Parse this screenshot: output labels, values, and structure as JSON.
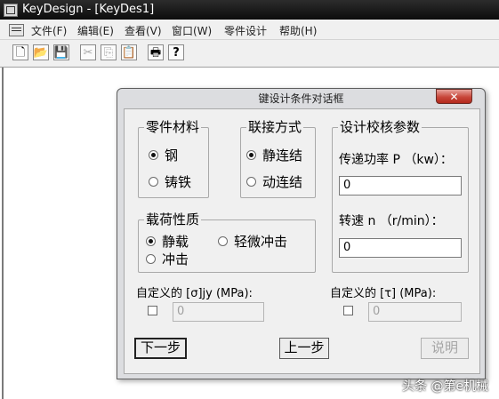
{
  "window": {
    "title": "KeyDesign - [KeyDes1]"
  },
  "menu": [
    "文件(F)",
    "编辑(E)",
    "查看(V)",
    "窗口(W)",
    "零件设计",
    "帮助(H)"
  ],
  "toolbar": {
    "new_icon": "new-file-icon",
    "open_icon": "open-folder-icon",
    "save_icon": "save-disk-icon",
    "cut_icon": "cut-icon",
    "copy_icon": "copy-icon",
    "paste_icon": "paste-icon",
    "print_icon": "print-icon",
    "help_icon": "help-icon",
    "glyphs": {
      "new": "🗋",
      "open": "📂",
      "save": "💾",
      "cut": "✂",
      "copy": "⎘",
      "paste": "📋",
      "print": "🖶",
      "help": "?"
    }
  },
  "dialog": {
    "title": "键设计条件对话框",
    "close_glyph": "✕",
    "material": {
      "legend": "零件材料",
      "options": [
        "钢",
        "铸铁"
      ],
      "selected": "钢"
    },
    "connection": {
      "legend": "联接方式",
      "options": [
        "静连结",
        "动连结"
      ],
      "selected": "静连结"
    },
    "load": {
      "legend": "载荷性质",
      "options": [
        "静载",
        "轻微冲击",
        "冲击"
      ],
      "selected": "静载"
    },
    "params": {
      "legend": "设计校核参数",
      "power_label": "传递功率 P （kw）：",
      "power_value": "0",
      "speed_label": "转速 n （r/min）：",
      "speed_value": "0"
    },
    "custom_sigma": {
      "label": "自定义的 [σ]jy  (MPa):",
      "checked": false,
      "value": "0"
    },
    "custom_tau": {
      "label": "自定义的 [τ]  (MPa):",
      "checked": false,
      "value": "0"
    },
    "buttons": {
      "next": "下一步",
      "prev": "上一步",
      "explain": "说明"
    }
  },
  "watermark": "头条 @第e机械"
}
